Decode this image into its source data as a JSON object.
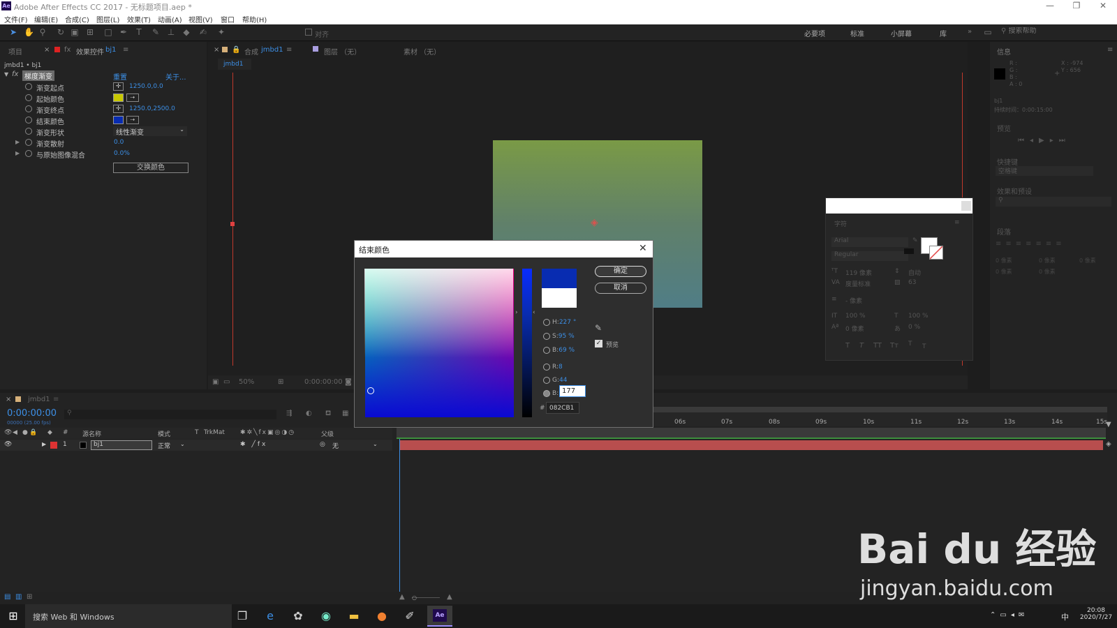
{
  "window": {
    "title": "Adobe After Effects CC 2017 - 无标题项目.aep *",
    "app_badge": "Ae"
  },
  "menu": [
    "文件(F)",
    "编辑(E)",
    "合成(C)",
    "图层(L)",
    "效果(T)",
    "动画(A)",
    "视图(V)",
    "窗口",
    "帮助(H)"
  ],
  "toolbar": {
    "align_label": "对齐"
  },
  "workspaces": [
    "必要项",
    "标准",
    "小屏幕",
    "库"
  ],
  "search_help": {
    "placeholder": "搜索帮助"
  },
  "effects_panel": {
    "tab_project": "项目",
    "tab_effect_controls": "效果控件",
    "tab_layer": "bj1",
    "breadcrumb": "jmbd1 • bj1",
    "effect_name": "梯度渐变",
    "reset": "重置",
    "about": "关于...",
    "props": [
      {
        "label": "渐变起点",
        "value": "1250.0,0.0"
      },
      {
        "label": "起始颜色",
        "value": ""
      },
      {
        "label": "渐变终点",
        "value": "1250.0,2500.0"
      },
      {
        "label": "结束颜色",
        "value": ""
      },
      {
        "label": "渐变形状",
        "value": "线性渐变"
      },
      {
        "label": "渐变散射",
        "value": "0.0"
      },
      {
        "label": "与原始图像混合",
        "value": "0.0%"
      }
    ],
    "swap_button": "交换颜色",
    "start_color": "#c8c800",
    "end_color": "#082cb1"
  },
  "comp_panel": {
    "tab_comp_prefix": "合成",
    "tab_comp": "jmbd1",
    "tab_layer": "图层 （无）",
    "tab_footage": "素材 （无）",
    "sub_tab": "jmbd1",
    "zoom": "50%",
    "timecode": "0:00:00:00"
  },
  "info_panel": {
    "title": "信息",
    "rgba": [
      "R :",
      "G :",
      "B :",
      "A : 0"
    ],
    "x": "X : -974",
    "y": "Y : 656",
    "layer": "bj1",
    "duration": "持续时间：0:00:15:00",
    "preview_title": "预览",
    "shortcut_title": "快捷键",
    "shortcut_value": "空格键",
    "effects_presets_title": "效果和预设",
    "paragraph_title": "段落",
    "para_vals": [
      "0 像素",
      "0 像素",
      "0 像素",
      "0 像素",
      "0 像素"
    ]
  },
  "character_panel": {
    "title": "字符",
    "font": "Arial",
    "style": "Regular",
    "size": "119 像素",
    "leading": "自动",
    "kerning": "度量标准",
    "tracking": "63",
    "stroke": "- 像素",
    "vscale": "100 %",
    "hscale": "100 %",
    "baseline": "0 像素",
    "tsume": "0 %",
    "styles": [
      "T",
      "T",
      "TT",
      "Tт",
      "T",
      "T"
    ]
  },
  "color_dialog": {
    "title": "结束颜色",
    "ok": "确定",
    "cancel": "取消",
    "preview_label": "预览",
    "h_label": "H:",
    "h_value": "227 °",
    "s_label": "S:",
    "s_value": "95 %",
    "b_label": "B:",
    "b_value": "69 %",
    "r_label": "R:",
    "r_value": "8",
    "g_label": "G:",
    "g_value": "44",
    "bl_label": "B:",
    "bl_value": "177",
    "hash": "#",
    "hex": "082CB1",
    "new_color": "#082cb1",
    "old_color": "#ffffff"
  },
  "timeline": {
    "tab": "jmbd1",
    "timecode": "0:00:00:00",
    "fps": "00000 (25.00 fps)",
    "cols": [
      "#",
      "源名称",
      "模式",
      "T",
      "TrkMat",
      "父级"
    ],
    "layer": {
      "num": "1",
      "name": "bj1",
      "mode": "正常",
      "parent": "无"
    },
    "ticks": [
      "06s",
      "07s",
      "08s",
      "09s",
      "10s",
      "11s",
      "12s",
      "13s",
      "14s",
      "15s"
    ]
  },
  "taskbar": {
    "search": "搜索 Web 和 Windows",
    "time": "20:08",
    "date": "2020/7/27",
    "ime": "中"
  },
  "watermark": {
    "brand": "Bai du 经验",
    "url": "jingyan.baidu.com"
  }
}
